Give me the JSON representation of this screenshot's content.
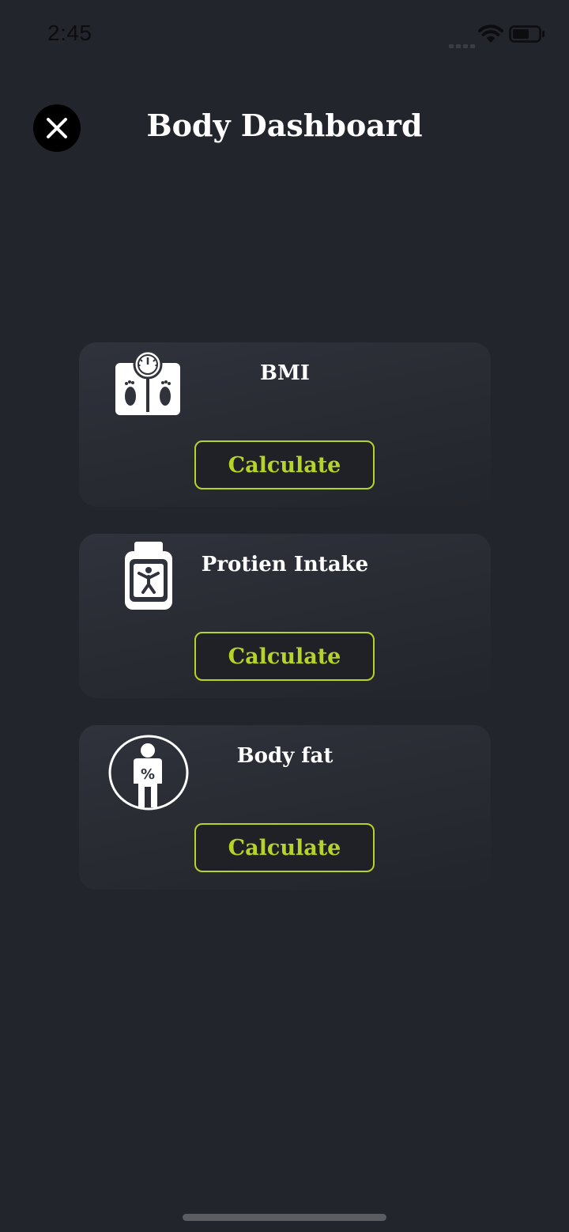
{
  "status_bar": {
    "time": "2:45"
  },
  "header": {
    "title": "Body Dashboard",
    "close_icon": "close-icon"
  },
  "cards": [
    {
      "title": "BMI",
      "icon": "scale-icon",
      "button_label": "Calculate"
    },
    {
      "title": "Protien Intake",
      "icon": "protein-jar-icon",
      "button_label": "Calculate"
    },
    {
      "title": "Body fat",
      "icon": "body-fat-icon",
      "button_label": "Calculate"
    }
  ],
  "colors": {
    "background": "#23252c",
    "accent": "#b6d327",
    "text": "#ffffff"
  }
}
